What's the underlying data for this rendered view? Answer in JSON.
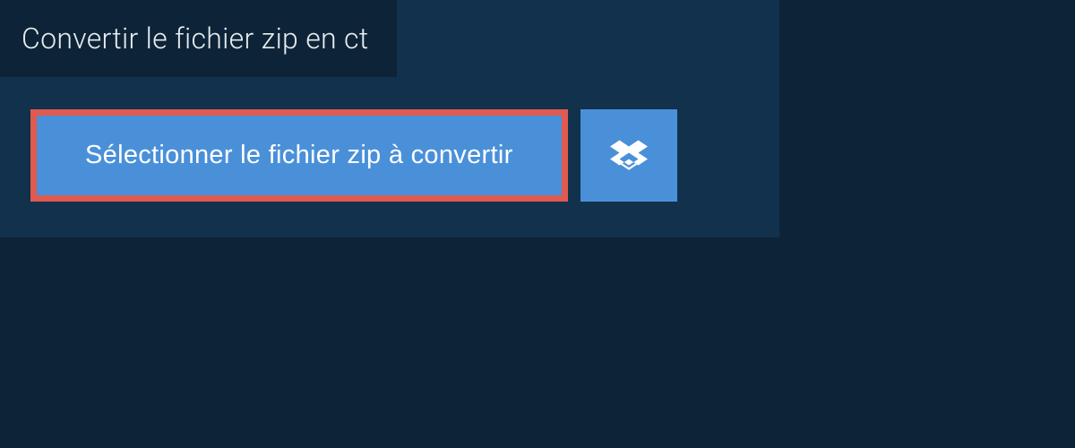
{
  "title": "Convertir le fichier zip en ct",
  "select_button_label": "Sélectionner le fichier zip à convertir",
  "dropbox_icon_name": "dropbox"
}
